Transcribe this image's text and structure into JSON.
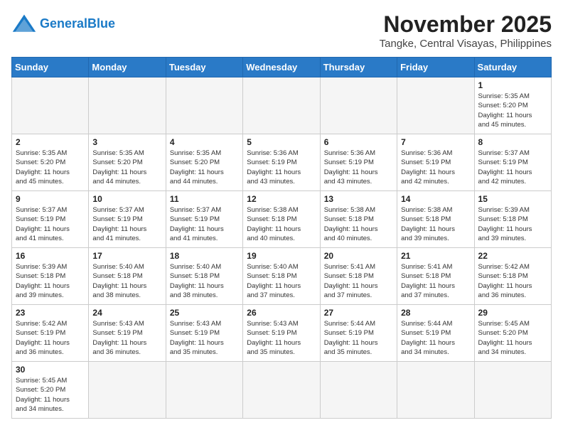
{
  "header": {
    "logo_general": "General",
    "logo_blue": "Blue",
    "month_year": "November 2025",
    "location": "Tangke, Central Visayas, Philippines"
  },
  "weekdays": [
    "Sunday",
    "Monday",
    "Tuesday",
    "Wednesday",
    "Thursday",
    "Friday",
    "Saturday"
  ],
  "weeks": [
    [
      {
        "day": "",
        "info": ""
      },
      {
        "day": "",
        "info": ""
      },
      {
        "day": "",
        "info": ""
      },
      {
        "day": "",
        "info": ""
      },
      {
        "day": "",
        "info": ""
      },
      {
        "day": "",
        "info": ""
      },
      {
        "day": "1",
        "info": "Sunrise: 5:35 AM\nSunset: 5:20 PM\nDaylight: 11 hours\nand 45 minutes."
      }
    ],
    [
      {
        "day": "2",
        "info": "Sunrise: 5:35 AM\nSunset: 5:20 PM\nDaylight: 11 hours\nand 45 minutes."
      },
      {
        "day": "3",
        "info": "Sunrise: 5:35 AM\nSunset: 5:20 PM\nDaylight: 11 hours\nand 44 minutes."
      },
      {
        "day": "4",
        "info": "Sunrise: 5:35 AM\nSunset: 5:20 PM\nDaylight: 11 hours\nand 44 minutes."
      },
      {
        "day": "5",
        "info": "Sunrise: 5:36 AM\nSunset: 5:19 PM\nDaylight: 11 hours\nand 43 minutes."
      },
      {
        "day": "6",
        "info": "Sunrise: 5:36 AM\nSunset: 5:19 PM\nDaylight: 11 hours\nand 43 minutes."
      },
      {
        "day": "7",
        "info": "Sunrise: 5:36 AM\nSunset: 5:19 PM\nDaylight: 11 hours\nand 42 minutes."
      },
      {
        "day": "8",
        "info": "Sunrise: 5:37 AM\nSunset: 5:19 PM\nDaylight: 11 hours\nand 42 minutes."
      }
    ],
    [
      {
        "day": "9",
        "info": "Sunrise: 5:37 AM\nSunset: 5:19 PM\nDaylight: 11 hours\nand 41 minutes."
      },
      {
        "day": "10",
        "info": "Sunrise: 5:37 AM\nSunset: 5:19 PM\nDaylight: 11 hours\nand 41 minutes."
      },
      {
        "day": "11",
        "info": "Sunrise: 5:37 AM\nSunset: 5:19 PM\nDaylight: 11 hours\nand 41 minutes."
      },
      {
        "day": "12",
        "info": "Sunrise: 5:38 AM\nSunset: 5:18 PM\nDaylight: 11 hours\nand 40 minutes."
      },
      {
        "day": "13",
        "info": "Sunrise: 5:38 AM\nSunset: 5:18 PM\nDaylight: 11 hours\nand 40 minutes."
      },
      {
        "day": "14",
        "info": "Sunrise: 5:38 AM\nSunset: 5:18 PM\nDaylight: 11 hours\nand 39 minutes."
      },
      {
        "day": "15",
        "info": "Sunrise: 5:39 AM\nSunset: 5:18 PM\nDaylight: 11 hours\nand 39 minutes."
      }
    ],
    [
      {
        "day": "16",
        "info": "Sunrise: 5:39 AM\nSunset: 5:18 PM\nDaylight: 11 hours\nand 39 minutes."
      },
      {
        "day": "17",
        "info": "Sunrise: 5:40 AM\nSunset: 5:18 PM\nDaylight: 11 hours\nand 38 minutes."
      },
      {
        "day": "18",
        "info": "Sunrise: 5:40 AM\nSunset: 5:18 PM\nDaylight: 11 hours\nand 38 minutes."
      },
      {
        "day": "19",
        "info": "Sunrise: 5:40 AM\nSunset: 5:18 PM\nDaylight: 11 hours\nand 37 minutes."
      },
      {
        "day": "20",
        "info": "Sunrise: 5:41 AM\nSunset: 5:18 PM\nDaylight: 11 hours\nand 37 minutes."
      },
      {
        "day": "21",
        "info": "Sunrise: 5:41 AM\nSunset: 5:18 PM\nDaylight: 11 hours\nand 37 minutes."
      },
      {
        "day": "22",
        "info": "Sunrise: 5:42 AM\nSunset: 5:18 PM\nDaylight: 11 hours\nand 36 minutes."
      }
    ],
    [
      {
        "day": "23",
        "info": "Sunrise: 5:42 AM\nSunset: 5:19 PM\nDaylight: 11 hours\nand 36 minutes."
      },
      {
        "day": "24",
        "info": "Sunrise: 5:43 AM\nSunset: 5:19 PM\nDaylight: 11 hours\nand 36 minutes."
      },
      {
        "day": "25",
        "info": "Sunrise: 5:43 AM\nSunset: 5:19 PM\nDaylight: 11 hours\nand 35 minutes."
      },
      {
        "day": "26",
        "info": "Sunrise: 5:43 AM\nSunset: 5:19 PM\nDaylight: 11 hours\nand 35 minutes."
      },
      {
        "day": "27",
        "info": "Sunrise: 5:44 AM\nSunset: 5:19 PM\nDaylight: 11 hours\nand 35 minutes."
      },
      {
        "day": "28",
        "info": "Sunrise: 5:44 AM\nSunset: 5:19 PM\nDaylight: 11 hours\nand 34 minutes."
      },
      {
        "day": "29",
        "info": "Sunrise: 5:45 AM\nSunset: 5:20 PM\nDaylight: 11 hours\nand 34 minutes."
      }
    ],
    [
      {
        "day": "30",
        "info": "Sunrise: 5:45 AM\nSunset: 5:20 PM\nDaylight: 11 hours\nand 34 minutes."
      },
      {
        "day": "",
        "info": ""
      },
      {
        "day": "",
        "info": ""
      },
      {
        "day": "",
        "info": ""
      },
      {
        "day": "",
        "info": ""
      },
      {
        "day": "",
        "info": ""
      },
      {
        "day": "",
        "info": ""
      }
    ]
  ]
}
